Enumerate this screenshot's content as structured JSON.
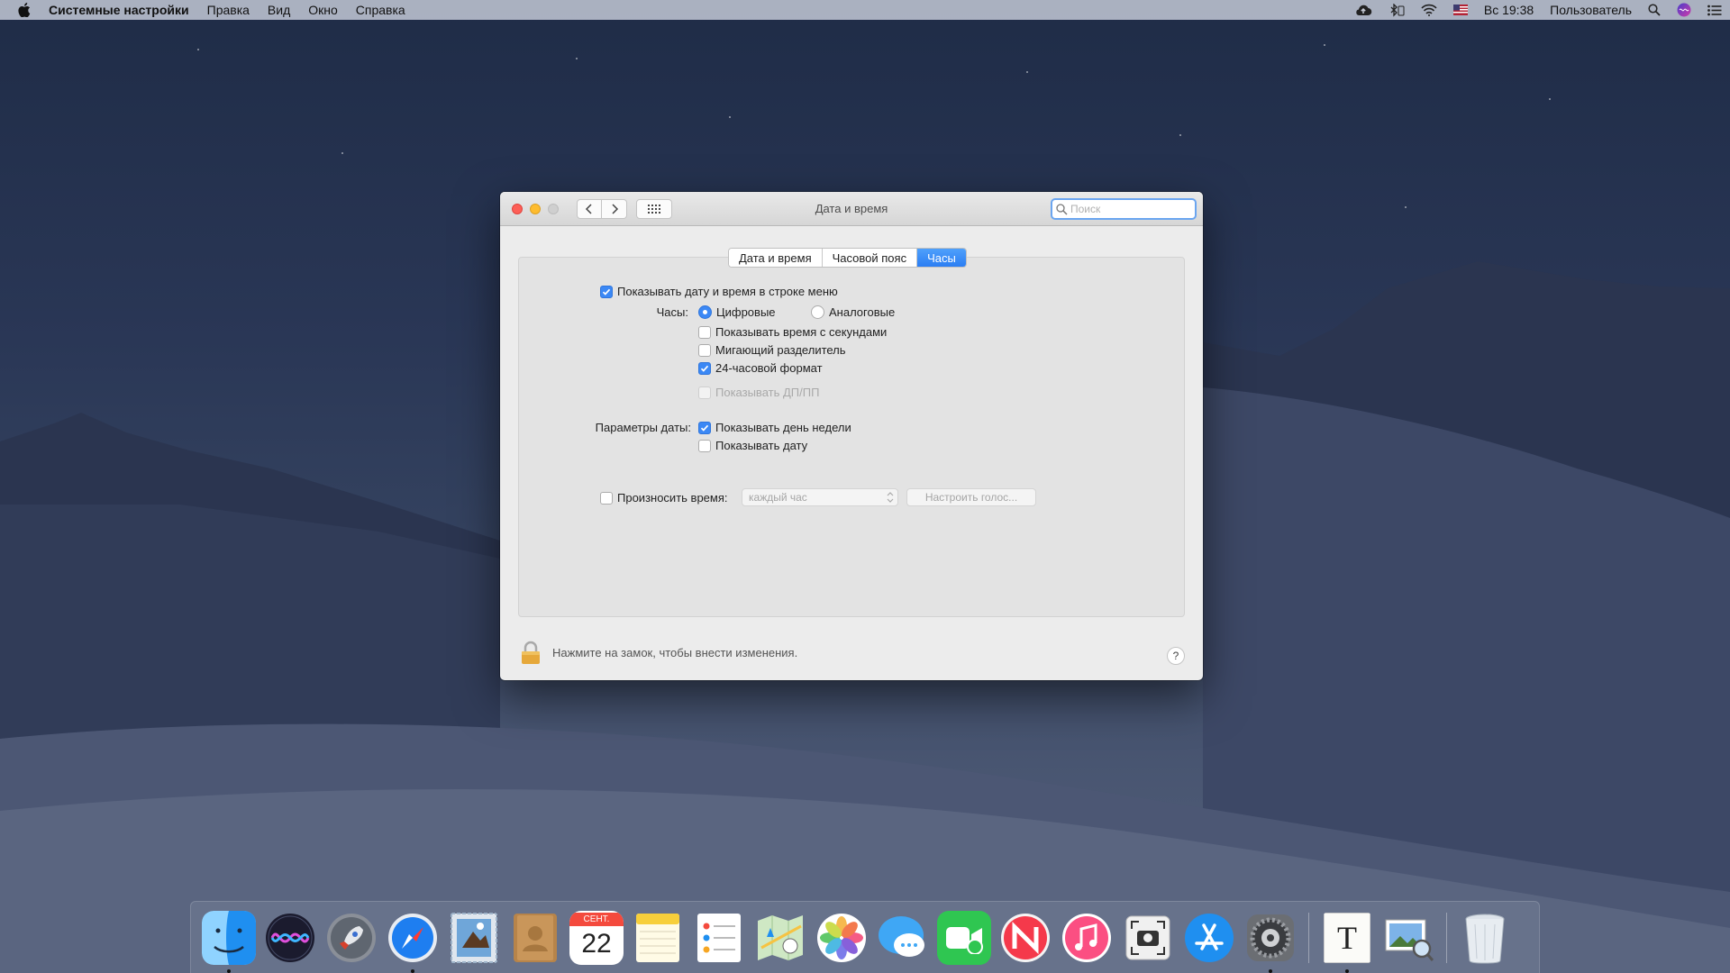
{
  "menubar": {
    "app_name": "Системные настройки",
    "items": [
      "Правка",
      "Вид",
      "Окно",
      "Справка"
    ],
    "clock": "Вс 19:38",
    "user": "Пользователь"
  },
  "window": {
    "title": "Дата и время",
    "search_placeholder": "Поиск",
    "tabs": [
      {
        "label": "Дата и время",
        "active": false
      },
      {
        "label": "Часовой пояс",
        "active": false
      },
      {
        "label": "Часы",
        "active": true
      }
    ],
    "show_in_menubar": {
      "label": "Показывать дату и время в строке меню",
      "checked": true
    },
    "clock_label": "Часы:",
    "clock_digital": {
      "label": "Цифровые",
      "selected": true
    },
    "clock_analog": {
      "label": "Аналоговые",
      "selected": false
    },
    "show_seconds": {
      "label": "Показывать время с секундами",
      "checked": false
    },
    "flash_separator": {
      "label": "Мигающий разделитель",
      "checked": false
    },
    "use_24h": {
      "label": "24-часовой формат",
      "checked": true
    },
    "show_ampm": {
      "label": "Показывать ДП/ПП",
      "checked": false,
      "enabled": false
    },
    "date_options_label": "Параметры даты:",
    "show_weekday": {
      "label": "Показывать день недели",
      "checked": true
    },
    "show_date": {
      "label": "Показывать дату",
      "checked": false
    },
    "announce_time": {
      "label": "Произносить время:",
      "checked": false
    },
    "announce_interval": "каждый час",
    "customize_voice": "Настроить голос...",
    "lock_text": "Нажмите на замок, чтобы внести изменения.",
    "help": "?"
  },
  "dock": {
    "items": [
      {
        "icon": "finder-icon",
        "running": true
      },
      {
        "icon": "siri-icon",
        "running": false
      },
      {
        "icon": "launchpad-icon",
        "running": false
      },
      {
        "icon": "safari-icon",
        "running": true
      },
      {
        "icon": "mail-icon",
        "running": false
      },
      {
        "icon": "contacts-icon",
        "running": false
      },
      {
        "icon": "calendar-icon",
        "running": false,
        "month": "СЕНТ.",
        "day": "22"
      },
      {
        "icon": "notes-icon",
        "running": false
      },
      {
        "icon": "reminders-icon",
        "running": false
      },
      {
        "icon": "maps-icon",
        "running": false
      },
      {
        "icon": "photos-icon",
        "running": false
      },
      {
        "icon": "messages-icon",
        "running": false
      },
      {
        "icon": "facetime-icon",
        "running": false
      },
      {
        "icon": "news-icon",
        "running": false
      },
      {
        "icon": "music-icon",
        "running": false
      },
      {
        "icon": "screenshot-icon",
        "running": false
      },
      {
        "icon": "app-store-icon",
        "running": false
      },
      {
        "icon": "system-preferences-icon",
        "running": true
      },
      {
        "icon": "textedit-icon",
        "running": true,
        "glyph": "T"
      },
      {
        "icon": "preview-icon",
        "running": false
      },
      {
        "icon": "trash-icon",
        "running": false
      }
    ]
  }
}
